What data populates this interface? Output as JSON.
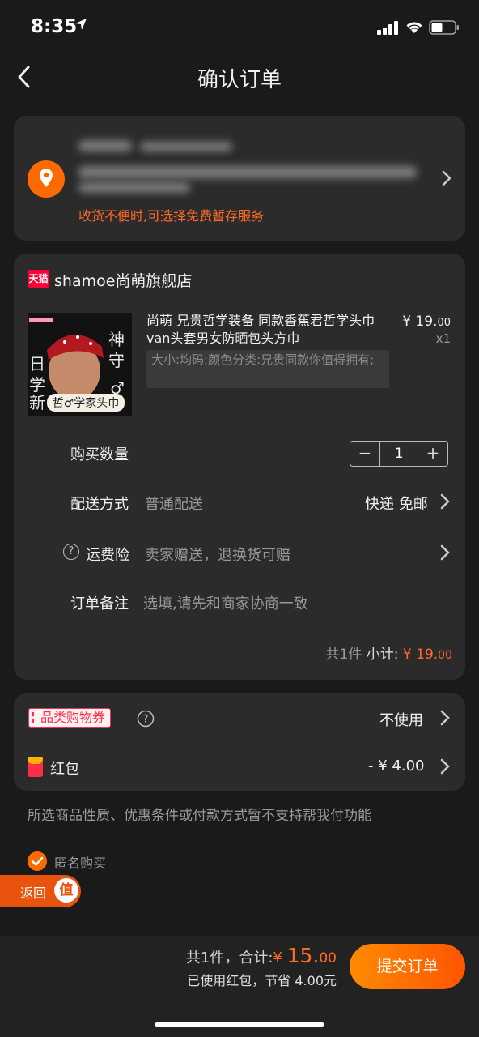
{
  "status": {
    "time": "8:35"
  },
  "nav": {
    "title": "确认订单"
  },
  "address": {
    "note": "收货不便时,可选择免费暂存服务"
  },
  "shop": {
    "badge": "天猫",
    "name": "shamoe尚萌旗舰店"
  },
  "product": {
    "title": "尚萌 兄贵哲学装备 同款香蕉君哲学头巾 van头套男女防晒包头方巾",
    "sku": "大小:均码;颜色分类:兄贵同款你值得拥有;",
    "price_main": "¥ 19.",
    "price_dec": "00",
    "qty": "x1",
    "image_caption": "哲♂学家头巾"
  },
  "rows": {
    "qty_label": "购买数量",
    "qty_value": "1",
    "qty_minus": "−",
    "qty_plus": "+",
    "delivery_label": "配送方式",
    "delivery_value": "普通配送",
    "delivery_right": "快递 免邮",
    "insurance_label": "运费险",
    "insurance_value": "卖家赠送，退换货可赔",
    "note_label": "订单备注",
    "note_placeholder": "选填,请先和商家协商一致"
  },
  "subtotal": {
    "count": "共1件",
    "label": "小计:",
    "amount": "¥ 19.",
    "amount_dec": "00"
  },
  "discounts": {
    "coupon_label": "品类购物券",
    "coupon_value": "不使用",
    "hongbao_label": "红包",
    "hongbao_value": "- ¥ 4.00"
  },
  "notice": "所选商品性质、优惠条件或付款方式暂不支持帮我付功能",
  "anonymous": {
    "label": "匿名购买",
    "checked": true
  },
  "float": {
    "back_label": "返回",
    "badge": "值"
  },
  "footer": {
    "total_prefix": "共1件，合计:",
    "currency": "¥",
    "total_int": "15.",
    "total_dec": "00",
    "saved": "已使用红包，节省 4.00元",
    "submit": "提交订单"
  },
  "colors": {
    "accent": "#ff6a00",
    "price": "#ff6a24",
    "tmall": "#ff0036",
    "background": "#1a1a1a",
    "card": "#2b2b2b"
  }
}
